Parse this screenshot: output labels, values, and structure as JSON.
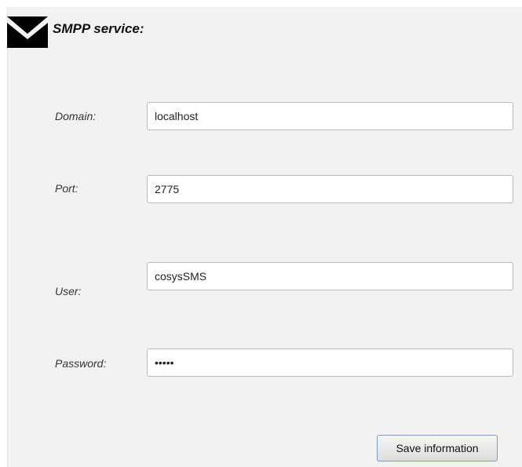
{
  "header": {
    "title": "SMPP service:",
    "icon": "mail-icon"
  },
  "form": {
    "domain": {
      "label": "Domain:",
      "value": "localhost"
    },
    "port": {
      "label": "Port:",
      "value": "2775"
    },
    "user": {
      "label": "User:",
      "value": "cosysSMS"
    },
    "password": {
      "label": "Password:",
      "value": "•••••"
    }
  },
  "actions": {
    "save_label": "Save information"
  }
}
